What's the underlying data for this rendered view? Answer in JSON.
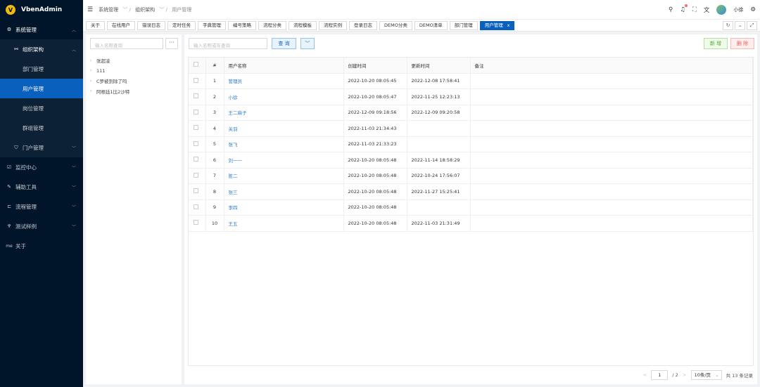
{
  "app": {
    "name": "VbenAdmin",
    "logo_letter": "V"
  },
  "sidebar": {
    "items": [
      {
        "label": "系统管理",
        "icon": "gear-icon",
        "arrow": "^"
      },
      {
        "label": "组织架构",
        "icon": "org-icon",
        "arrow": "^"
      },
      {
        "label": "部门管理"
      },
      {
        "label": "用户管理"
      },
      {
        "label": "岗位管理"
      },
      {
        "label": "群组管理"
      },
      {
        "label": "门户管理",
        "icon": "shield-icon",
        "arrow": "v"
      },
      {
        "label": "监控中心",
        "icon": "monitor-icon",
        "arrow": "v"
      },
      {
        "label": "辅助工具",
        "icon": "tool-icon",
        "arrow": "v"
      },
      {
        "label": "流程管理",
        "icon": "flow-icon",
        "arrow": "v"
      },
      {
        "label": "测试样例",
        "icon": "trophy-icon",
        "arrow": "v"
      },
      {
        "label": "关于",
        "icon_text": "me"
      }
    ]
  },
  "header": {
    "breadcrumb": [
      "系统管理",
      "组织架构",
      "用户管理"
    ],
    "username": "小徐",
    "accent": "#0960bd"
  },
  "tabs": [
    {
      "label": "关于"
    },
    {
      "label": "在线用户"
    },
    {
      "label": "错误日志"
    },
    {
      "label": "定时任务"
    },
    {
      "label": "字典管理"
    },
    {
      "label": "编号策略"
    },
    {
      "label": "流程分类"
    },
    {
      "label": "流程模板"
    },
    {
      "label": "流程实例"
    },
    {
      "label": "登录日志"
    },
    {
      "label": "DEMO分类"
    },
    {
      "label": "DEMO清单"
    },
    {
      "label": "部门管理"
    },
    {
      "label": "用户管理",
      "close": "x"
    }
  ],
  "tree": {
    "search_placeholder": "输入名称查询",
    "more": "···",
    "nodes": [
      "张超凌",
      "111",
      "C罗被到除了吗",
      "阿根廷1比2沙特"
    ]
  },
  "table_panel": {
    "search_placeholder": "输入名称或车查询",
    "query_button": "查 询",
    "add_button": "新 增",
    "delete_button": "删 除",
    "columns": [
      "#",
      "用户名称",
      "创建时间",
      "更新时间",
      "备注"
    ],
    "rows": [
      {
        "idx": "1",
        "name": "管理员",
        "created": "2022-10-20 08:05:45",
        "updated": "2022-12-08 17:58:41",
        "remark": ""
      },
      {
        "idx": "2",
        "name": "小徐",
        "created": "2022-10-20 08:05:47",
        "updated": "2022-11-25 12:23:13",
        "remark": ""
      },
      {
        "idx": "3",
        "name": "王二麻子",
        "created": "2022-12-09 09:18:56",
        "updated": "2022-12-09 09:20:58",
        "remark": ""
      },
      {
        "idx": "4",
        "name": "关羽",
        "created": "2022-11-03 21:34:43",
        "updated": "",
        "remark": ""
      },
      {
        "idx": "5",
        "name": "张飞",
        "created": "2022-11-03 21:33:23",
        "updated": "",
        "remark": ""
      },
      {
        "idx": "6",
        "name": "刘一一",
        "created": "2022-10-20 08:05:48",
        "updated": "2022-11-14 18:58:29",
        "remark": ""
      },
      {
        "idx": "7",
        "name": "陈二",
        "created": "2022-10-20 08:05:48",
        "updated": "2022-10-24 17:56:07",
        "remark": ""
      },
      {
        "idx": "8",
        "name": "张三",
        "created": "2022-10-20 08:05:48",
        "updated": "2022-11-27 15:25:41",
        "remark": ""
      },
      {
        "idx": "9",
        "name": "李四",
        "created": "2022-10-20 08:05:48",
        "updated": "",
        "remark": ""
      },
      {
        "idx": "10",
        "name": "王五",
        "created": "2022-10-20 08:05:48",
        "updated": "2022-11-03 21:31:49",
        "remark": ""
      }
    ]
  },
  "pagination": {
    "prev": "<",
    "current_page": "1",
    "total_pages": "/ 2",
    "next": ">",
    "page_size": "10条/页",
    "total": "共 13 条记录"
  }
}
